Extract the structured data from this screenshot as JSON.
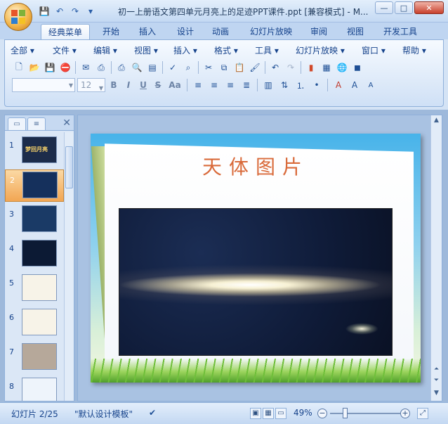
{
  "window": {
    "title": "初一上册语文第四单元月亮上的足迹PPT课件.ppt [兼容模式] - M...",
    "min_label": "—",
    "max_label": "□",
    "close_label": "✕"
  },
  "qat": [
    "💾",
    "↶",
    "↷",
    "▾"
  ],
  "tabs": [
    {
      "label": "经典菜单",
      "active": true
    },
    {
      "label": "开始"
    },
    {
      "label": "插入"
    },
    {
      "label": "设计"
    },
    {
      "label": "动画"
    },
    {
      "label": "幻灯片放映"
    },
    {
      "label": "审阅"
    },
    {
      "label": "视图"
    },
    {
      "label": "开发工具"
    }
  ],
  "classic_menu": [
    "全部 ▾",
    "文件 ▾",
    "编辑 ▾",
    "视图 ▾",
    "插入 ▾",
    "格式 ▾",
    "工具 ▾",
    "幻灯片放映 ▾",
    "窗口 ▾",
    "帮助 ▾"
  ],
  "format": {
    "font_name": "",
    "font_size": "12",
    "bold": "B",
    "italic": "I",
    "underline": "U",
    "strike": "S",
    "shadow": "Aa"
  },
  "left_pane": {
    "slides_tab": "▭",
    "outline_tab": "≡",
    "close": "✕",
    "thumbnails": [
      {
        "num": "1",
        "bg": "#1c2c4a",
        "text": "梦回月亮"
      },
      {
        "num": "2",
        "bg": "#15305c",
        "selected": true
      },
      {
        "num": "3",
        "bg": "#1a3a66"
      },
      {
        "num": "4",
        "bg": "#0c1a34"
      },
      {
        "num": "5",
        "bg": "#f7f3e8"
      },
      {
        "num": "6",
        "bg": "#f7f3e8"
      },
      {
        "num": "7",
        "bg": "#b6a89a"
      },
      {
        "num": "8",
        "bg": "#eef4fb"
      }
    ]
  },
  "slide": {
    "title": "天体图片"
  },
  "status": {
    "slide_info": "幻灯片 2/25",
    "template": "\"默认设计模板\"",
    "zoom": "49%",
    "zoom_level": 0.49
  }
}
